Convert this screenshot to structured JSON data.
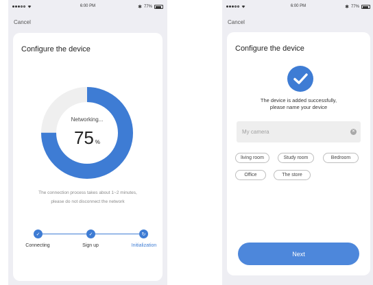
{
  "left": {
    "status": {
      "time": "6:00 PM",
      "battery": "77%"
    },
    "cancel": "Cancel",
    "title": "Configure the device",
    "progress": {
      "label": "Networking...",
      "value": "75",
      "unit": "%",
      "fraction": 0.75
    },
    "hint_line1": "The connection process takes about 1~2 minutes,",
    "hint_line2": "please do not disconnect the network",
    "steps": [
      "Connecting",
      "Sign up",
      "Initialization"
    ],
    "accent": "#3e7cd4"
  },
  "right": {
    "status": {
      "time": "6:00 PM",
      "battery": "77%"
    },
    "cancel": "Cancel",
    "title": "Configure the device",
    "success_line1": "The device is added successfully,",
    "success_line2": "please name your device",
    "name_input": {
      "placeholder": "My camera",
      "value": ""
    },
    "rooms": [
      "living room",
      "Study room",
      "Bedroom",
      "Office",
      "The store"
    ],
    "next_label": "Next",
    "accent": "#4d87db"
  }
}
